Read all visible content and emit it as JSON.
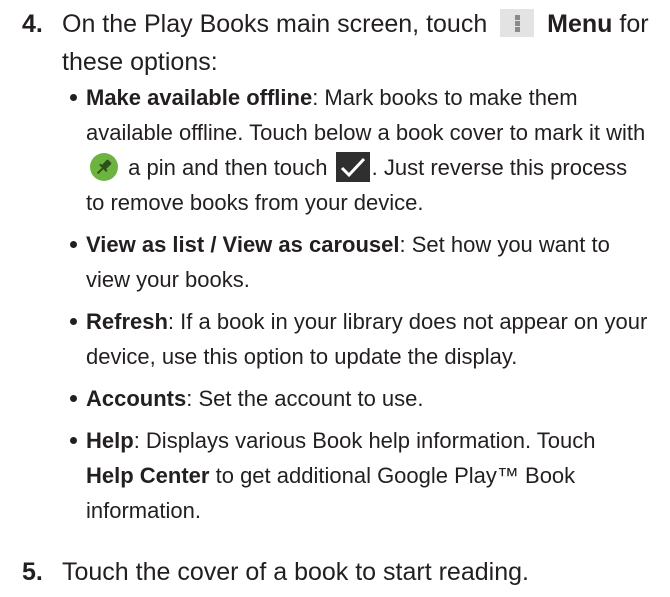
{
  "step4": {
    "number": "4.",
    "text_before": "On the Play Books main screen, touch",
    "menu_label": "Menu",
    "text_after": "for these options:"
  },
  "bullets": [
    {
      "term": "Make available offline",
      "text1": ": Mark books to make them available offline. Touch below a book cover to mark it with",
      "text2": "a pin and then touch",
      "text3": ". Just reverse this process to remove books from your device."
    },
    {
      "term": "View as list / View as carousel",
      "text": ": Set how you want to view your books."
    },
    {
      "term": "Refresh",
      "text": ": If a book in your library does not appear on your device, use this option to update the display."
    },
    {
      "term": "Accounts",
      "text": ": Set the account to use."
    },
    {
      "term": "Help",
      "text1": ": Displays various Book help information. Touch",
      "term2": "Help Center",
      "text2": "to get additional Google Play™ Book information."
    }
  ],
  "step5": {
    "number": "5.",
    "text": "Touch the cover of a book to start reading."
  },
  "icons": {
    "menu": "menu-icon",
    "pin": "pin-icon",
    "check": "checkmark-icon"
  },
  "colors": {
    "pin_background": "#6db33f",
    "check_background": "#2f2f2f",
    "menu_background": "#e3e3e3"
  }
}
